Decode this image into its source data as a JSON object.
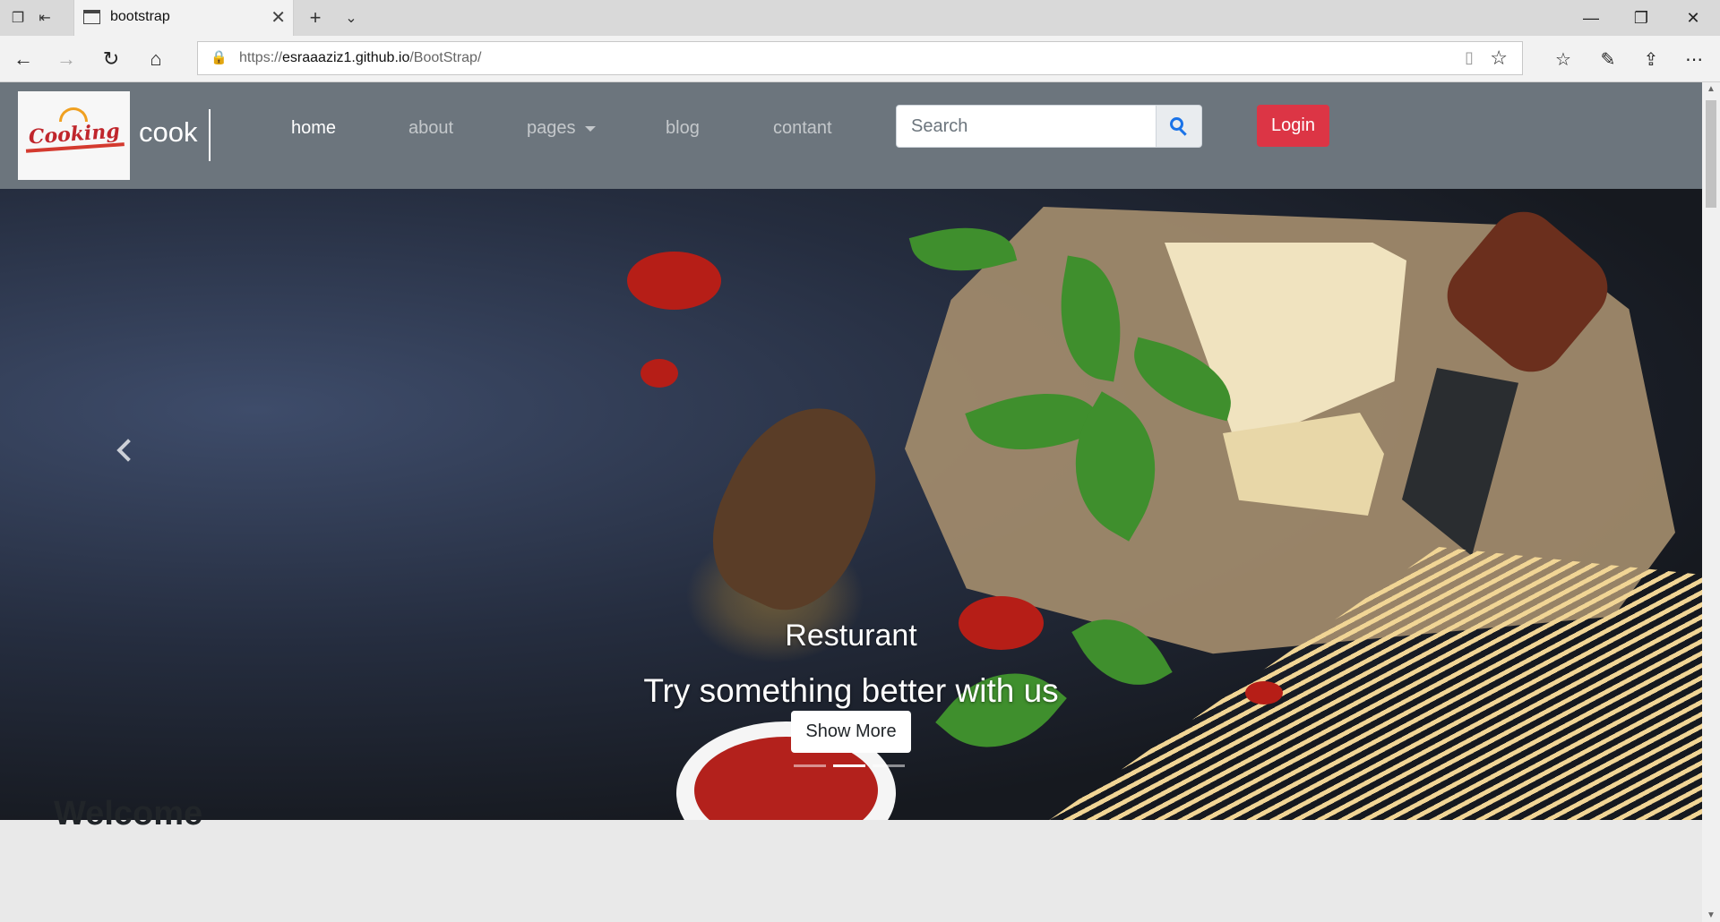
{
  "browser": {
    "tab_title": "bootstrap",
    "url_scheme": "https://",
    "url_host": "esraaaziz1.github.io",
    "url_path": "/BootStrap/"
  },
  "navbar": {
    "brand_logo_text": "Cooking",
    "brand": "cook",
    "links": [
      {
        "label": "home",
        "active": true
      },
      {
        "label": "about",
        "active": false
      },
      {
        "label": "pages",
        "active": false
      },
      {
        "label": "blog",
        "active": false
      },
      {
        "label": "contant",
        "active": false
      }
    ],
    "search_placeholder": "Search",
    "login_label": "Login"
  },
  "carousel": {
    "caption_title": "Resturant",
    "caption_subtitle": "Try something better with us",
    "button_label": "Show More",
    "slide_count": 3,
    "active_slide": 2
  },
  "content": {
    "heading": "Welcome"
  },
  "colors": {
    "navbar_bg": "#6c757d",
    "login_bg": "#dc3545",
    "search_icon": "#1a73e8"
  }
}
